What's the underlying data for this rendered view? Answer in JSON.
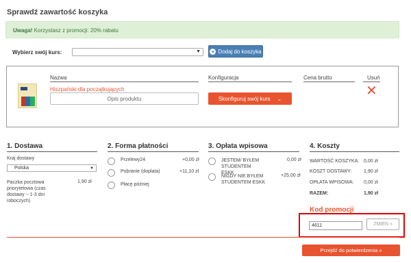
{
  "page_title": "Sprawdź zawartość koszyka",
  "alert": {
    "strong": "Uwaga!",
    "text": " Korzystasz z promocji: 20% rabatu"
  },
  "course": {
    "label": "Wybierz swój kurs:",
    "selected": "",
    "add_button": "Dodaj do koszyka"
  },
  "cart": {
    "headers": {
      "name": "Nazwa",
      "config": "Konfiguracja",
      "price": "Cena brutto",
      "remove": "Usuń"
    },
    "item": {
      "name": "Hiszpański dla początkujących",
      "desc_button": "Opis produktu",
      "config_button": "Skonfiguruj swój kurs"
    }
  },
  "delivery": {
    "title": "1. Dostawa",
    "country_label": "Kraj dostawy",
    "country_selected": "Polska",
    "option_text": "Paczka pocztowa priorytetowa (czas dostawy ~ 1-3 dni roboczych)",
    "option_price": "1,90 zł"
  },
  "payment": {
    "title": "2. Forma płatności",
    "options": [
      {
        "label": "Przelewy24",
        "price": "+0,00 zł"
      },
      {
        "label": "Pobranie (doplata)",
        "price": "+11,10 zł"
      },
      {
        "label": "Płacę później",
        "price": ""
      }
    ]
  },
  "fee": {
    "title": "3. Opłata wpisowa",
    "options": [
      {
        "label": "JESTEM/ BYŁEM STUDENTEM ESKK",
        "price": "0,00 zł"
      },
      {
        "label": "NIGDY NIE BYŁEM STUDENTEM ESKK",
        "price": "+25,00 zł"
      }
    ]
  },
  "costs": {
    "title": "4. Koszty",
    "rows": [
      {
        "label": "WARTOŚĆ KOSZYKA:",
        "value": "0,00 zł"
      },
      {
        "label": "KOSZT DOSTAWY:",
        "value": "1,90 zł"
      },
      {
        "label": "OPŁATA WPISOWA:",
        "value": "0,00 zł"
      },
      {
        "label": "RAZEM:",
        "value": "1,90 zł"
      }
    ]
  },
  "promo": {
    "title": "Kod promocji",
    "value": "4611",
    "change_button": "ZMIEŃ »"
  },
  "confirm_button": "Przejdź do potwierdzenia »",
  "colors": {
    "accent": "#e8542f",
    "blue": "#4a7fb5",
    "alert_bg": "#dff0d8",
    "highlight": "#e00000"
  }
}
